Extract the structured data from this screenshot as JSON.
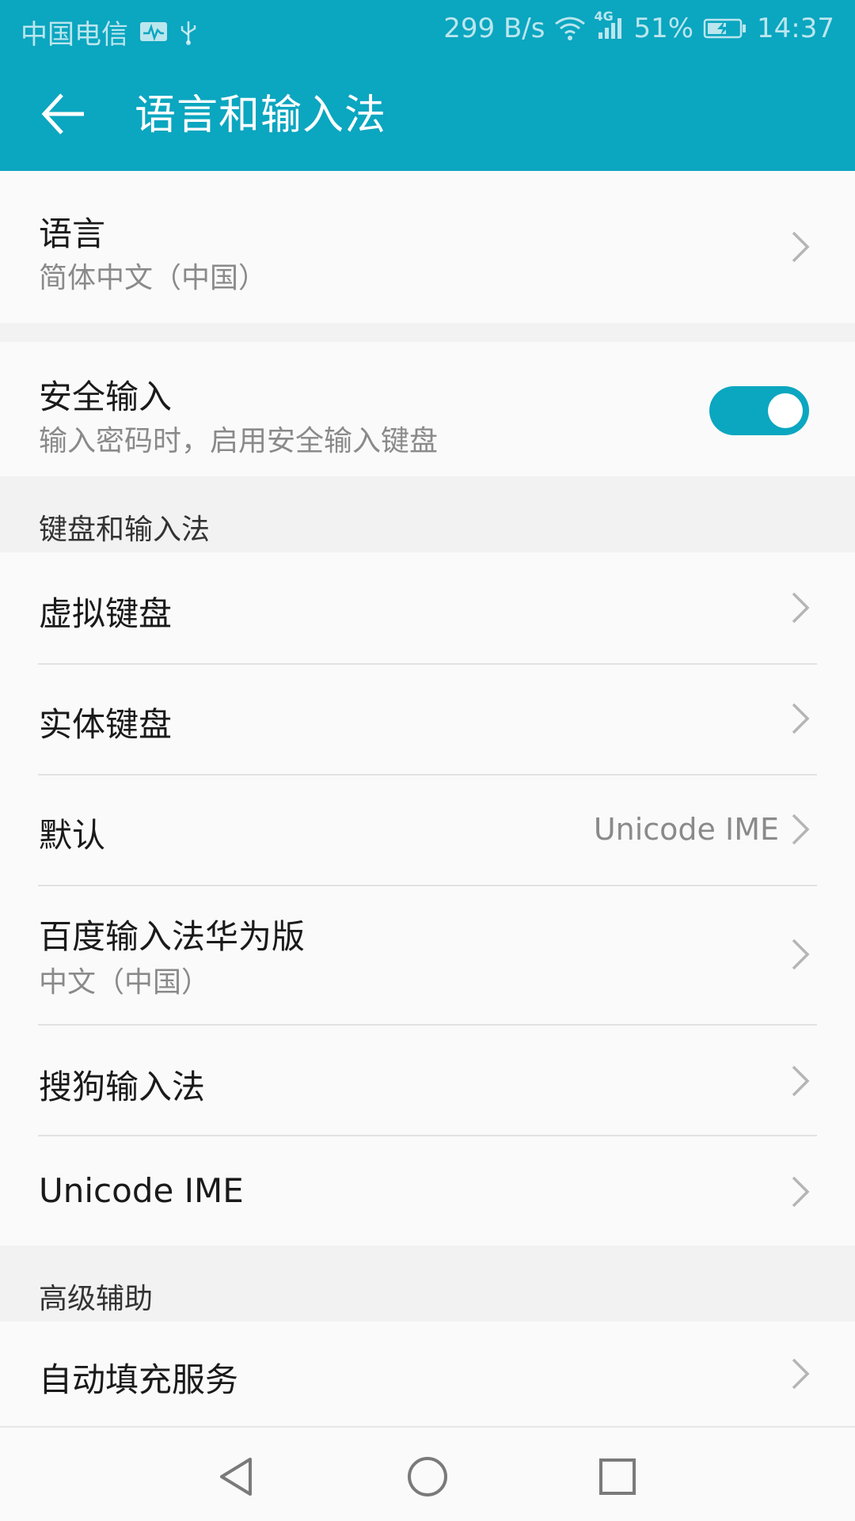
{
  "status_bar": {
    "carrier": "中国电信",
    "net_speed": "299 B/s",
    "network_type": "4G",
    "battery": "51%",
    "time": "14:37",
    "icons": [
      "activity-monitor-icon",
      "usb-icon",
      "wifi-icon",
      "signal-icon",
      "battery-charging-icon"
    ]
  },
  "app_bar": {
    "title": "语言和输入法",
    "back_icon": "arrow-left-icon"
  },
  "language": {
    "title": "语言",
    "subtitle": "简体中文（中国）"
  },
  "secure_input": {
    "title": "安全输入",
    "subtitle": "输入密码时，启用安全输入键盘",
    "enabled": true
  },
  "sections": {
    "keyboard": "键盘和输入法",
    "advanced": "高级辅助"
  },
  "keyboard_items": [
    {
      "title": "虚拟键盘"
    },
    {
      "title": "实体键盘"
    },
    {
      "title": "默认",
      "value": "Unicode IME"
    },
    {
      "title": "百度输入法华为版",
      "subtitle": "中文（中国）"
    },
    {
      "title": "搜狗输入法"
    },
    {
      "title": "Unicode IME"
    }
  ],
  "advanced_items": [
    {
      "title": "自动填充服务"
    }
  ],
  "colors": {
    "accent": "#0ba6c0",
    "background": "#f2f2f2",
    "card": "#fafafa",
    "primary_text": "#1a1a1a",
    "secondary_text": "#8a8a8a"
  }
}
